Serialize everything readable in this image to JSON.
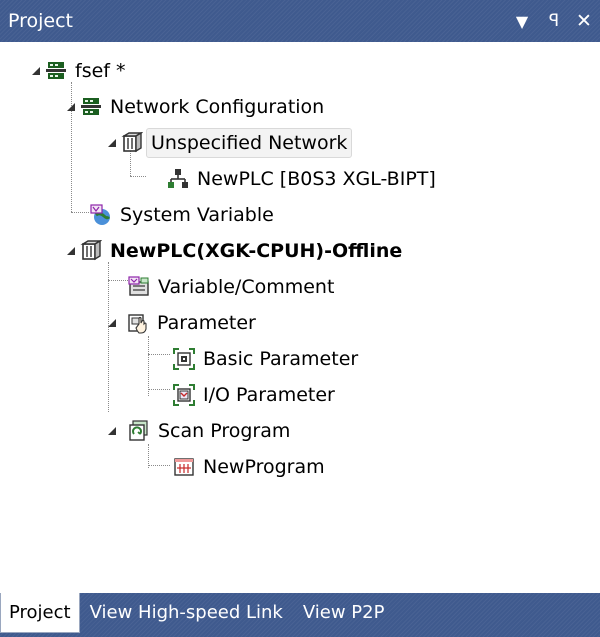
{
  "panel": {
    "title": "Project",
    "dropdown_icon": "▼",
    "pin_icon": "ꟼ",
    "close_icon": "✕"
  },
  "tree": {
    "nodes": [
      {
        "label": "fsef *",
        "icon": "project-network-icon"
      },
      {
        "label": "Network Configuration",
        "icon": "network-config-icon"
      },
      {
        "label": "Unspecified Network",
        "icon": "network-icon"
      },
      {
        "label": "NewPLC [B0S3 XGL-BIPT]",
        "icon": "plc-node-icon"
      },
      {
        "label": "System Variable",
        "icon": "system-variable-icon"
      },
      {
        "label": "NewPLC(XGK-CPUH)-Offline",
        "icon": "plc-icon"
      },
      {
        "label": "Variable/Comment",
        "icon": "variable-comment-icon"
      },
      {
        "label": "Parameter",
        "icon": "parameter-icon"
      },
      {
        "label": "Basic Parameter",
        "icon": "basic-parameter-icon"
      },
      {
        "label": "I/O Parameter",
        "icon": "io-parameter-icon"
      },
      {
        "label": "Scan Program",
        "icon": "scan-program-icon"
      },
      {
        "label": "NewProgram",
        "icon": "program-icon"
      }
    ]
  },
  "tabs": [
    {
      "label": "Project",
      "active": true
    },
    {
      "label": "View High-speed Link",
      "active": false
    },
    {
      "label": "View P2P",
      "active": false
    }
  ]
}
